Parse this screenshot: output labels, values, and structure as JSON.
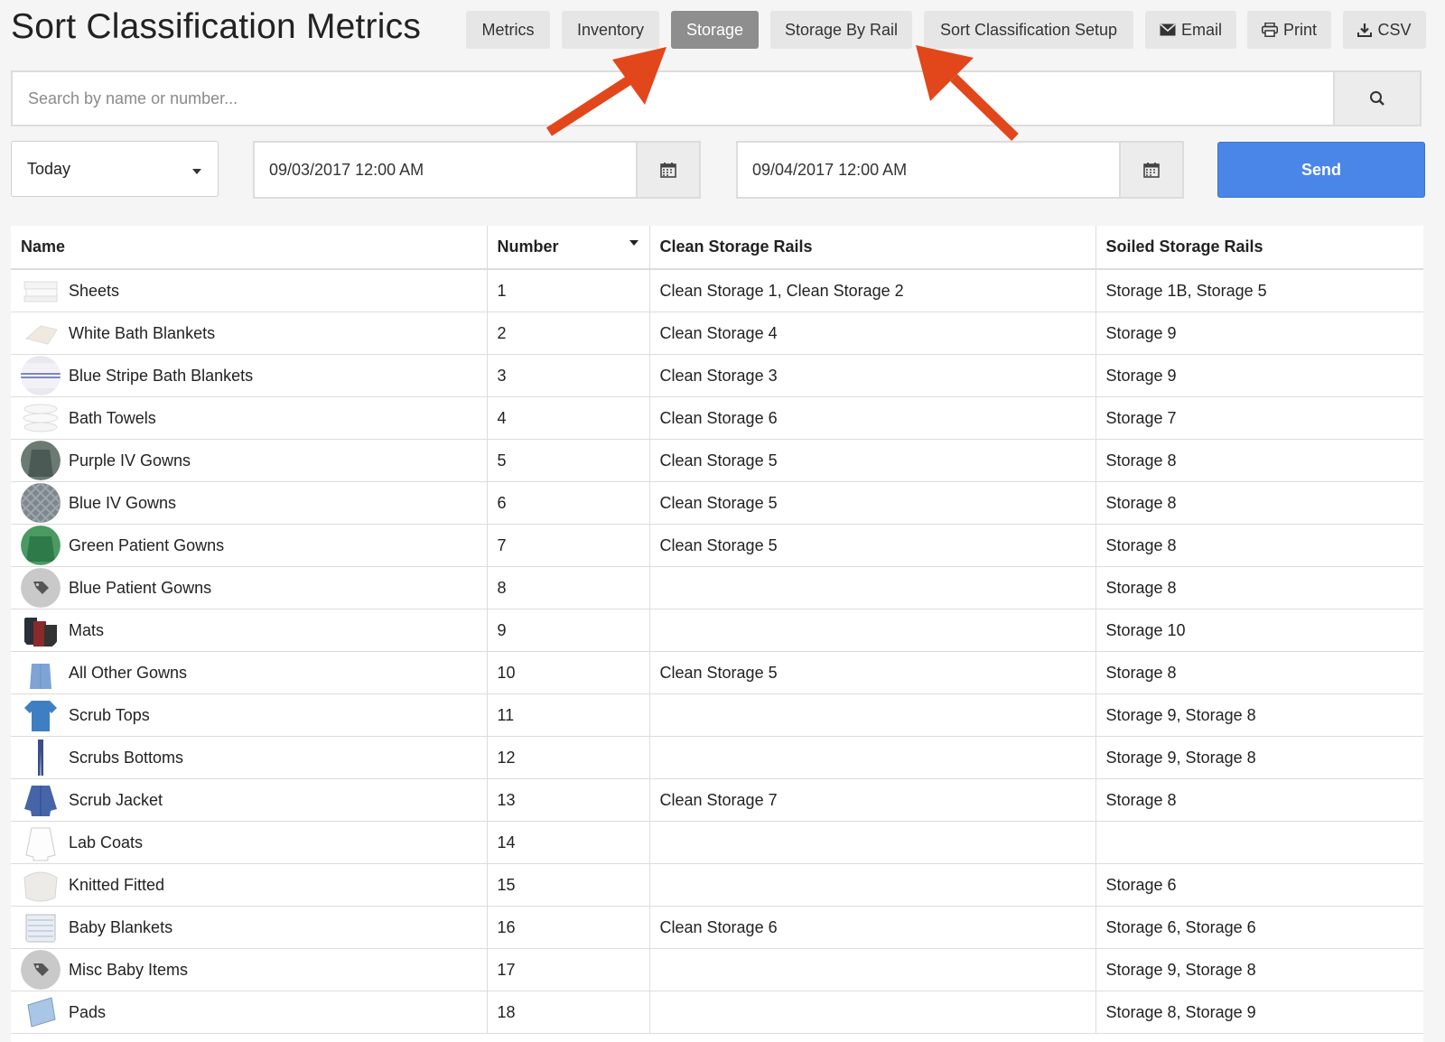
{
  "header": {
    "title": "Sort Classification Metrics",
    "tabs": [
      {
        "label": "Metrics",
        "active": false
      },
      {
        "label": "Inventory",
        "active": false
      },
      {
        "label": "Storage",
        "active": true
      },
      {
        "label": "Storage By Rail",
        "active": false
      },
      {
        "label": "Sort Classification Setup",
        "active": false
      }
    ],
    "actions": [
      {
        "label": "Email",
        "icon": "envelope-icon"
      },
      {
        "label": "Print",
        "icon": "printer-icon"
      },
      {
        "label": "CSV",
        "icon": "download-icon"
      }
    ]
  },
  "search": {
    "placeholder": "Search by name or number...",
    "value": ""
  },
  "filters": {
    "range": "Today",
    "start": "09/03/2017 12:00 AM",
    "end": "09/04/2017 12:00 AM",
    "send_label": "Send"
  },
  "table": {
    "columns": [
      "Name",
      "Number",
      "Clean Storage Rails",
      "Soiled Storage Rails"
    ],
    "rows": [
      {
        "name": "Sheets",
        "number": "1",
        "clean": "Clean Storage 1, Clean Storage 2",
        "soiled": "Storage 1B, Storage 5",
        "thumb": "sheets"
      },
      {
        "name": "White Bath Blankets",
        "number": "2",
        "clean": "Clean Storage 4",
        "soiled": "Storage 9",
        "thumb": "blanket"
      },
      {
        "name": "Blue Stripe Bath Blankets",
        "number": "3",
        "clean": "Clean Storage 3",
        "soiled": "Storage 9",
        "thumb": "stripe"
      },
      {
        "name": "Bath Towels",
        "number": "4",
        "clean": "Clean Storage 6",
        "soiled": "Storage 7",
        "thumb": "towels"
      },
      {
        "name": "Purple IV Gowns",
        "number": "5",
        "clean": "Clean Storage 5",
        "soiled": "Storage 8",
        "thumb": "purple"
      },
      {
        "name": "Blue IV Gowns",
        "number": "6",
        "clean": "Clean Storage 5",
        "soiled": "Storage 8",
        "thumb": "bluepattern"
      },
      {
        "name": "Green Patient Gowns",
        "number": "7",
        "clean": "Clean Storage 5",
        "soiled": "Storage 8",
        "thumb": "green"
      },
      {
        "name": "Blue Patient Gowns",
        "number": "8",
        "clean": "",
        "soiled": "Storage 8",
        "thumb": "tag"
      },
      {
        "name": "Mats",
        "number": "9",
        "clean": "",
        "soiled": "Storage 10",
        "thumb": "mats"
      },
      {
        "name": "All Other Gowns",
        "number": "10",
        "clean": "Clean Storage 5",
        "soiled": "Storage 8",
        "thumb": "gown"
      },
      {
        "name": "Scrub Tops",
        "number": "11",
        "clean": "",
        "soiled": "Storage 9, Storage 8",
        "thumb": "scrubtop"
      },
      {
        "name": "Scrubs Bottoms",
        "number": "12",
        "clean": "",
        "soiled": "Storage 9, Storage 8",
        "thumb": "scrubbottom"
      },
      {
        "name": "Scrub Jacket",
        "number": "13",
        "clean": "Clean Storage 7",
        "soiled": "Storage 8",
        "thumb": "jacket"
      },
      {
        "name": "Lab Coats",
        "number": "14",
        "clean": "",
        "soiled": "",
        "thumb": "labcoat"
      },
      {
        "name": "Knitted Fitted",
        "number": "15",
        "clean": "",
        "soiled": "Storage 6",
        "thumb": "knitted"
      },
      {
        "name": "Baby Blankets",
        "number": "16",
        "clean": "Clean Storage 6",
        "soiled": "Storage 6, Storage 6",
        "thumb": "baby"
      },
      {
        "name": "Misc Baby Items",
        "number": "17",
        "clean": "",
        "soiled": "Storage 9, Storage 8",
        "thumb": "tag"
      },
      {
        "name": "Pads",
        "number": "18",
        "clean": "",
        "soiled": "Storage 8, Storage 9",
        "thumb": "pads"
      }
    ]
  },
  "colors": {
    "accent": "#4a86e8",
    "active_tab": "#8e8e8e",
    "annotation_arrow": "#e2461b"
  }
}
